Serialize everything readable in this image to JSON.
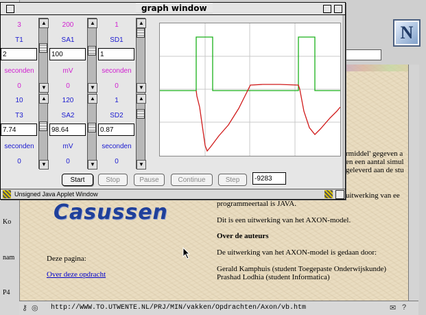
{
  "browser": {
    "url": "http://WWW.TO.UTWENTE.NL/PRJ/MIN/vakken/Opdrachten/Axon/vb.htm",
    "left_labels": [
      "Ko",
      "nam",
      "P4"
    ],
    "logo_letter": "N"
  },
  "page": {
    "brand": "Casussen",
    "right_lines": [
      "rmiddel' gegeven a",
      "en een aantal simul",
      "geleverd aan de stu"
    ],
    "uitwerking_tail": "uitwerking van ee",
    "language_line": "programmeertaal is JAVA.",
    "axon_line": "Dit is een uitwerking van het AXON-model.",
    "authors_heading": "Over de auteurs",
    "authors_intro": "De uitwerking van het AXON-model is gedaan door:",
    "author1": "Gerald Kamphuis (student Toegepaste Onderwijskunde)",
    "author2": "Prashad Lodhia (student Informatica)",
    "deze_pagina": "Deze pagina:",
    "opdracht_link": "Over deze opdracht"
  },
  "applet": {
    "title": "graph window",
    "status_text": "Unsigned Java Applet Window",
    "top_group": [
      {
        "max": "3",
        "name": "T1",
        "value": "2",
        "unit": "seconden",
        "min": "0"
      },
      {
        "max": "200",
        "name": "SA1",
        "value": "100",
        "unit": "mV",
        "min": "0"
      },
      {
        "max": "1",
        "name": "SD1",
        "value": "1",
        "unit": "seconden",
        "min": "0"
      }
    ],
    "bottom_group": [
      {
        "max": "10",
        "name": "T3",
        "value": "7.74",
        "unit": "seconden",
        "min": "0"
      },
      {
        "max": "120",
        "name": "SA2",
        "value": "98.64",
        "unit": "mV",
        "min": "0"
      },
      {
        "max": "1",
        "name": "SD2",
        "value": "0.87",
        "unit": "seconden",
        "min": "0"
      }
    ],
    "buttons": {
      "start": "Start",
      "stop": "Stop",
      "pause": "Pause",
      "continue": "Continue",
      "step": "Step"
    },
    "counter": "-9283",
    "colors": {
      "stimulus": "#19b019",
      "response": "#d01a1a",
      "grid": "#c8c8c8",
      "pink": "#d020d0",
      "blue": "#1a1ad0"
    }
  }
}
